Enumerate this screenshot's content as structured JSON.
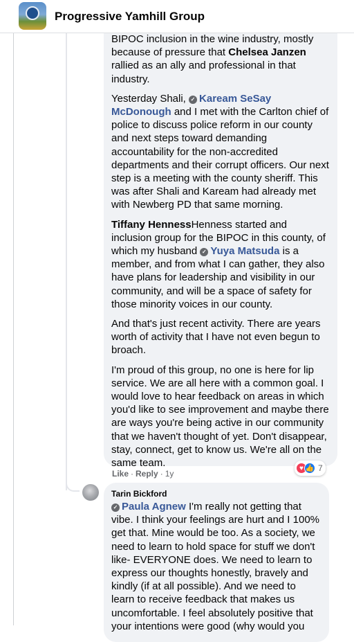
{
  "header": {
    "group_name": "Progressive Yamhill Group"
  },
  "comment1": {
    "p1_a": "BIPOC inclusion in the wine industry, mostly because of pressure that ",
    "p1_mention": "Chelsea Janzen",
    "p1_b": " rallied as an ally and professional in that industry.",
    "p2_a": "Yesterday Shali, ",
    "p2_mention": "Kaream SeSay McDonough",
    "p2_b": " and I met with the Carlton chief of police to discuss police reform in our county and next steps toward demanding accountability for the non-accredited departments and their corrupt officers. Our next step is a meeting with the county sheriff. This was after Shali and Kaream had already met with Newberg PD that same morning.",
    "p3_name": "Tiffany Henness",
    "p3_a": "Henness started and inclusion group for the BIPOC in this county, of which my husband ",
    "p3_mention": "Yuya Matsuda",
    "p3_b": " is a member, and from what I can gather, they also have plans for leadership and visibility in our community, and will be a space of safety for those minority voices in our county.",
    "p4": "And that's just recent activity. There are years worth of activity that I have not even begun to broach.",
    "p5": "I'm proud of this group, no one is here for lip service. We are all here with a common goal. I would love to hear feedback on areas in which you'd like to see improvement and maybe there are ways you're being active in our community that we haven't thought of yet. Don't disappear, stay, connect, get to know us. We're all on the same team.",
    "actions": {
      "like": "Like",
      "reply": "Reply",
      "time": "1y"
    },
    "reactions": {
      "count": "7",
      "types": [
        "love-icon",
        "like-icon"
      ]
    }
  },
  "comment2": {
    "author": "Tarin Bickford",
    "mention": "Paula Agnew",
    "text": " I'm really not getting that vibe. I think your feelings are hurt and I 100% get that. Mine would be too. As a society, we need to learn to hold space for stuff we don't like- EVERYONE does. We need to learn to express our thoughts honestly, bravely and kindly (if at all possible). And we need to learn to receive feedback that makes us uncomfortable. I feel absolutely positive that your intentions were good (why would you"
  },
  "colors": {
    "link": "#385898",
    "bubble": "#f0f2f5",
    "meta": "#65676b",
    "love": "#f33e58",
    "like": "#1877f2"
  }
}
